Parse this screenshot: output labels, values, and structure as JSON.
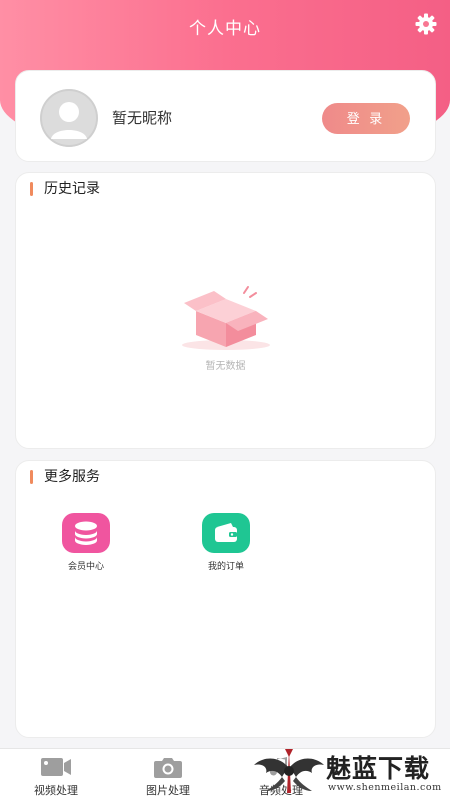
{
  "header": {
    "title": "个人中心",
    "settings_icon": "gear-icon"
  },
  "profile": {
    "avatar_icon": "avatar-icon",
    "nickname": "暂无昵称",
    "login_label": "登 录"
  },
  "history": {
    "title": "历史记录",
    "empty_icon": "empty-box-icon",
    "empty_text": "暂无数据"
  },
  "services": {
    "title": "更多服务",
    "items": [
      {
        "label": "会员中心",
        "icon": "coins-icon",
        "color": "#f0559f"
      },
      {
        "label": "我的订单",
        "icon": "wallet-icon",
        "color": "#1fc693"
      }
    ]
  },
  "tabbar": {
    "items": [
      {
        "label": "视频处理",
        "icon": "video-camera-icon"
      },
      {
        "label": "图片处理",
        "icon": "camera-icon"
      },
      {
        "label": "音频处理",
        "icon": "audio-icon"
      }
    ]
  },
  "watermark": {
    "name": "魅蓝下载",
    "url": "www.shenmeilan.com"
  },
  "colors": {
    "header_start": "#ff8fa5",
    "header_end": "#f45f85",
    "accent_bar": "#f08a5d",
    "login_start": "#ef8a8a",
    "login_end": "#f1a08a"
  }
}
